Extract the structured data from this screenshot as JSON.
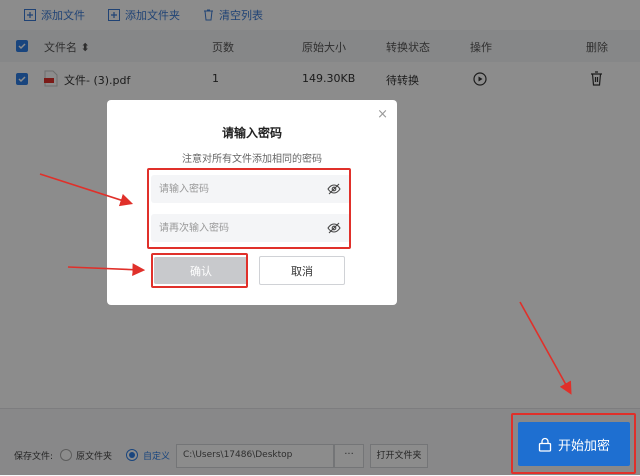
{
  "toolbar": {
    "add_file": "添加文件",
    "add_folder": "添加文件夹",
    "clear_list": "清空列表"
  },
  "table": {
    "headers": {
      "filename": "文件名 ⬍",
      "pages": "页数",
      "size": "原始大小",
      "status": "转换状态",
      "action": "操作",
      "delete": "删除"
    },
    "rows": [
      {
        "filename": "文件- (3).pdf",
        "pages": "1",
        "size": "149.30KB",
        "status": "待转换"
      }
    ]
  },
  "modal": {
    "title": "请输入密码",
    "subtitle": "注意对所有文件添加相同的密码",
    "password_placeholder": "请输入密码",
    "confirm_placeholder": "请再次输入密码",
    "ok_label": "确认",
    "cancel_label": "取消",
    "close_glyph": "×"
  },
  "footer": {
    "save_label": "保存文件:",
    "option_original": "原文件夹",
    "option_custom": "自定义",
    "path_value": "C:\\Users\\17486\\Desktop",
    "browse_label": "···",
    "open_folder_label": "打开文件夹",
    "encrypt_label": "开始加密"
  },
  "colors": {
    "accent": "#2f7ee5",
    "annotation": "#e0302a"
  }
}
